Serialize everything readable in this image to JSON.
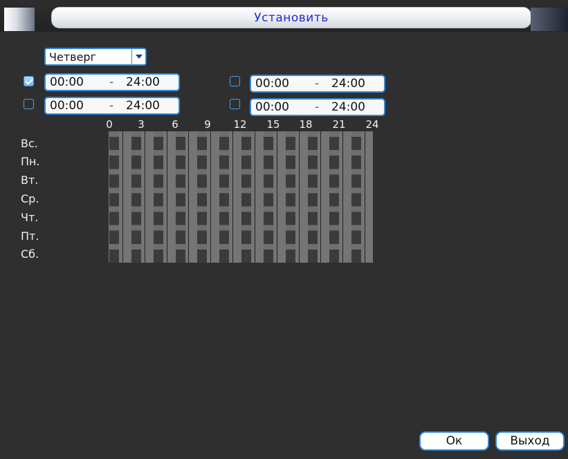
{
  "window": {
    "title": "Установить"
  },
  "day_select": {
    "value": "Четверг"
  },
  "periods": [
    {
      "checked": true,
      "start": "00:00",
      "sep": "-",
      "end": "24:00"
    },
    {
      "checked": false,
      "start": "00:00",
      "sep": "-",
      "end": "24:00"
    },
    {
      "checked": false,
      "start": "00:00",
      "sep": "-",
      "end": "24:00"
    },
    {
      "checked": false,
      "start": "00:00",
      "sep": "-",
      "end": "24:00"
    }
  ],
  "hours": [
    "0",
    "3",
    "6",
    "9",
    "12",
    "15",
    "18",
    "21",
    "24"
  ],
  "days": [
    "Вс.",
    "Пн.",
    "Вт.",
    "Ср.",
    "Чт.",
    "Пт.",
    "Сб."
  ],
  "buttons": {
    "ok": "Ок",
    "exit": "Выход"
  },
  "colors": {
    "title_text": "#1f2bd0",
    "accent_border": "#2f8ae0",
    "background": "#2f2f2f"
  }
}
